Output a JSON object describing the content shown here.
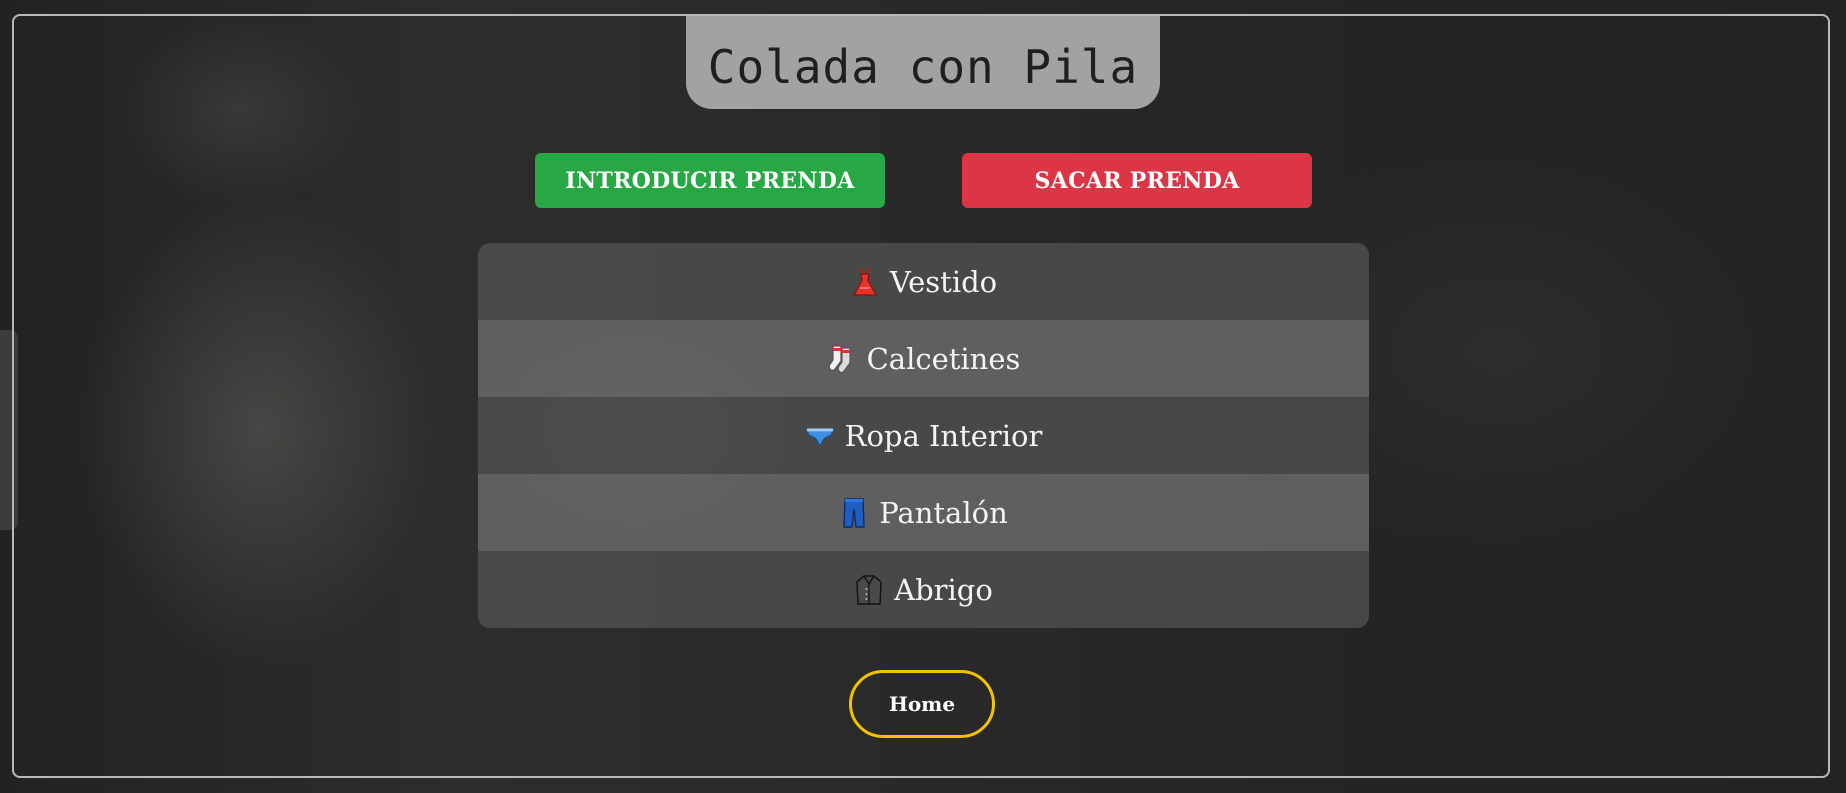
{
  "header": {
    "title": "Colada con Pila"
  },
  "actions": {
    "push_label": "INTRODUCIR PRENDA",
    "pop_label": "SACAR PRENDA"
  },
  "stack": {
    "items": [
      {
        "label": "Vestido",
        "icon": "dress-icon"
      },
      {
        "label": "Calcetines",
        "icon": "socks-icon"
      },
      {
        "label": "Ropa Interior",
        "icon": "underwear-icon"
      },
      {
        "label": "Pantalón",
        "icon": "jeans-icon"
      },
      {
        "label": "Abrigo",
        "icon": "coat-icon"
      }
    ]
  },
  "nav": {
    "home_label": "Home"
  },
  "colors": {
    "push": "#28a745",
    "pop": "#dc3545",
    "home_border": "#f2c200",
    "title_tab": "#a2a2a2"
  }
}
